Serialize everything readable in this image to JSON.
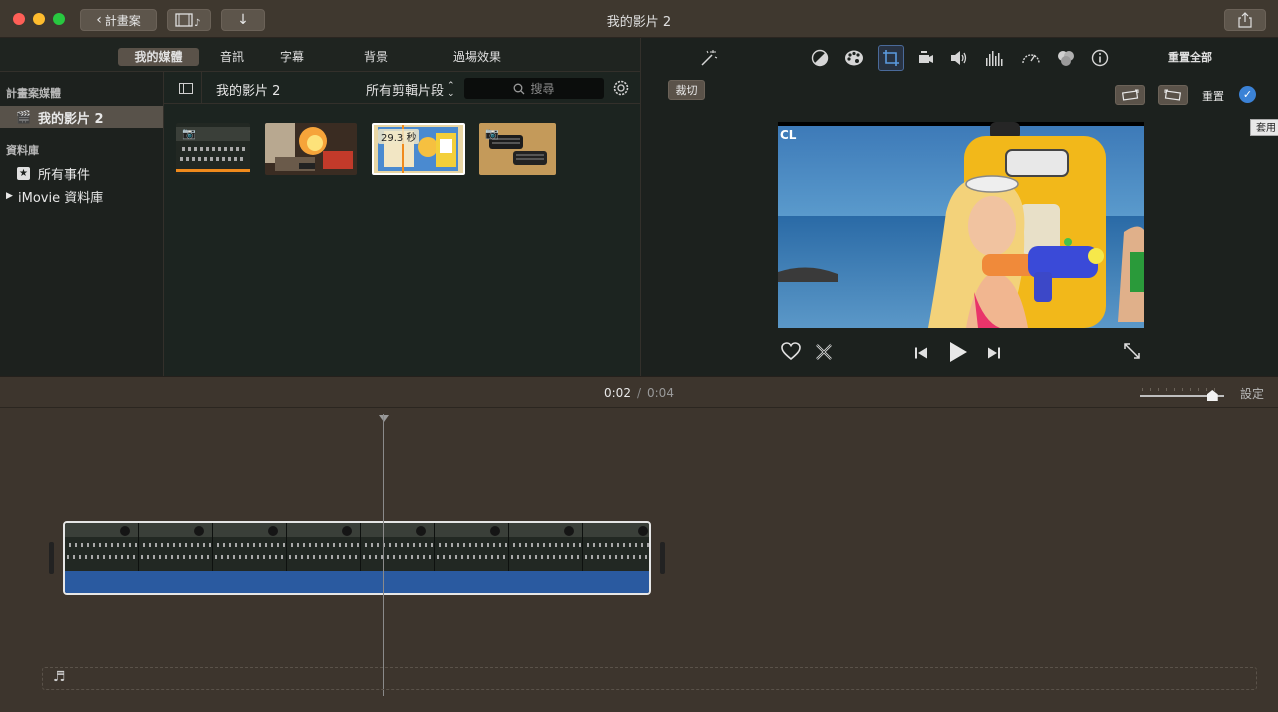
{
  "window": {
    "title": "我的影片 2",
    "back_label": "計畫案",
    "traffic": {
      "close": "#fe5f57",
      "minimize": "#febc2e",
      "zoom": "#28c840"
    }
  },
  "browser_tabs": [
    "我的媒體",
    "音訊",
    "字幕",
    "背景",
    "過場效果"
  ],
  "sidebar": {
    "project_media_header": "計畫案媒體",
    "project_item": "我的影片 2",
    "libraries_header": "資料庫",
    "all_events": "所有事件",
    "library": "iMovie 資料庫"
  },
  "browser": {
    "title": "我的影片 2",
    "filter": "所有剪輯片段",
    "search_placeholder": "搜尋",
    "thumbnails": [
      {
        "kind": "photo",
        "selected": false
      },
      {
        "kind": "video",
        "selected": false
      },
      {
        "kind": "video",
        "selected": true,
        "duration_label": "29.3 秒"
      },
      {
        "kind": "photo",
        "selected": false
      }
    ]
  },
  "viewer": {
    "reset_all": "重置全部",
    "crop_label": "裁切",
    "reset_label": "重置",
    "apply_tooltip": "套用",
    "overlay_text": "CL"
  },
  "timeline": {
    "current_time": "0:02",
    "separator": "/",
    "total_time": "0:04",
    "settings_label": "設定",
    "zoom_level": 0.86
  },
  "colors": {
    "accent_blue": "#3b82d6",
    "orange_bar": "#f08a1c",
    "audio_blue": "#2a5aa0"
  }
}
